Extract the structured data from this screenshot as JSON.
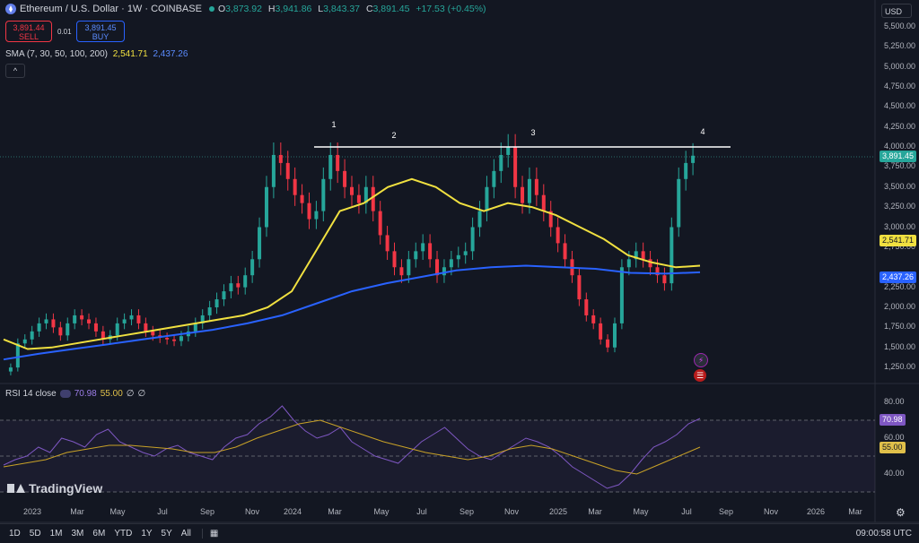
{
  "header": {
    "symbol": "Ethereum / U.S. Dollar · 1W · COINBASE",
    "o_label": "O",
    "o": "3,873.92",
    "h_label": "H",
    "h": "3,941.86",
    "l_label": "L",
    "l": "3,843.37",
    "c_label": "C",
    "c": "3,891.45",
    "change": "+17.53 (+0.45%)"
  },
  "trade": {
    "sell_price": "3,891.44",
    "sell_label": "SELL",
    "spread": "0.01",
    "buy_price": "3,891.45",
    "buy_label": "BUY"
  },
  "sma_legend": {
    "label": "SMA (7, 30, 50, 100, 200)",
    "v1": "2,541.71",
    "v2": "2,437.26"
  },
  "collapse_glyph": "^",
  "rsi_legend": {
    "label": "RSI 14 close",
    "v1": "70.98",
    "v2": "55.00",
    "v3": "∅",
    "v4": "∅"
  },
  "currency": "USD",
  "price_axis": [
    "5,500.00",
    "5,250.00",
    "5,000.00",
    "4,750.00",
    "4,500.00",
    "4,250.00",
    "4,000.00",
    "3,750.00",
    "3,500.00",
    "3,250.00",
    "3,000.00",
    "2,750.00",
    "2,250.00",
    "2,000.00",
    "1,750.00",
    "1,500.00",
    "1,250.00"
  ],
  "rsi_axis": [
    "80.00",
    "60.00",
    "40.00"
  ],
  "badges": {
    "price": "3,891.45",
    "sma_yellow": "2,541.71",
    "sma_blue": "2,437.26",
    "rsi": "70.98",
    "rsi_ma": "55.00"
  },
  "time_axis": [
    "2023",
    "Mar",
    "May",
    "Jul",
    "Sep",
    "Nov",
    "2024",
    "Mar",
    "May",
    "Jul",
    "Sep",
    "Nov",
    "2025",
    "Mar",
    "May",
    "Jul",
    "Sep",
    "Nov",
    "2026",
    "Mar"
  ],
  "timeframes": [
    "1D",
    "5D",
    "1M",
    "3M",
    "6M",
    "YTD",
    "1Y",
    "5Y",
    "All"
  ],
  "clock": "09:00:58 UTC",
  "brand": "TradingView",
  "annotations": [
    "1",
    "2",
    "3",
    "4"
  ],
  "colors": {
    "up": "#26a69a",
    "down": "#f23645",
    "sma_fast": "#f0e040",
    "sma_slow": "#2962ff",
    "rsi": "#7e57c2",
    "rsi_ma": "#c9a227",
    "bg": "#131722"
  },
  "chart_data": {
    "type": "candlestick",
    "title": "Ethereum / U.S. Dollar · 1W · COINBASE",
    "ylim": [
      1100,
      5650
    ],
    "resistance_level": 4000,
    "annotated_peaks": [
      "1",
      "2",
      "3",
      "4"
    ],
    "series": [
      {
        "name": "SMA",
        "values_approx": [
          1600,
          1480,
          1500,
          1550,
          1600,
          1650,
          1700,
          1750,
          1800,
          1850,
          1900,
          2000,
          2200,
          2700,
          3200,
          3300,
          3500,
          3600,
          3500,
          3300,
          3200,
          3300,
          3250,
          3150,
          3000,
          2850,
          2650,
          2560,
          2500,
          2520
        ]
      },
      {
        "name": "SMA",
        "values_approx": [
          1350,
          1420,
          1480,
          1540,
          1600,
          1660,
          1720,
          1800,
          1900,
          2050,
          2200,
          2300,
          2380,
          2460,
          2500,
          2520,
          2500,
          2480,
          2430,
          2420,
          2437
        ]
      }
    ],
    "rsi": {
      "ylim": [
        25,
        90
      ],
      "overbought": 70,
      "oversold": 30,
      "last": 70.98,
      "ma_last": 55.0
    }
  }
}
